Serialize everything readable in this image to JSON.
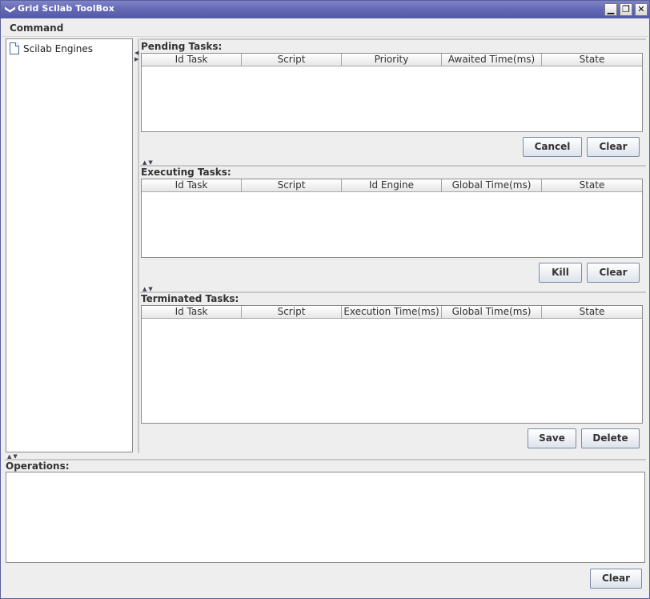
{
  "window": {
    "title": "Grid Scilab ToolBox",
    "sysmenu_glyph": "❯",
    "min_glyph": "▁",
    "max_glyph": "❐",
    "close_glyph": "✕"
  },
  "menubar": {
    "command_label": "Command"
  },
  "tree": {
    "root_label": "Scilab Engines"
  },
  "pending": {
    "title": "Pending Tasks:",
    "columns": [
      "Id Task",
      "Script",
      "Priority",
      "Awaited Time(ms)",
      "State"
    ],
    "buttons": {
      "cancel": "Cancel",
      "clear": "Clear"
    }
  },
  "executing": {
    "title": "Executing Tasks:",
    "columns": [
      "Id Task",
      "Script",
      "Id Engine",
      "Global Time(ms)",
      "State"
    ],
    "buttons": {
      "kill": "Kill",
      "clear": "Clear"
    }
  },
  "terminated": {
    "title": "Terminated Tasks:",
    "columns": [
      "Id Task",
      "Script",
      "Execution Time(ms)",
      "Global Time(ms)",
      "State"
    ],
    "buttons": {
      "save": "Save",
      "delete": "Delete"
    }
  },
  "operations": {
    "title": "Operations:",
    "clear_label": "Clear"
  },
  "colors": {
    "titlebar": "#6368b4",
    "window_bg": "#eeeeee",
    "border": "#8a8a8a"
  },
  "splitter_glyphs": "▲▼"
}
